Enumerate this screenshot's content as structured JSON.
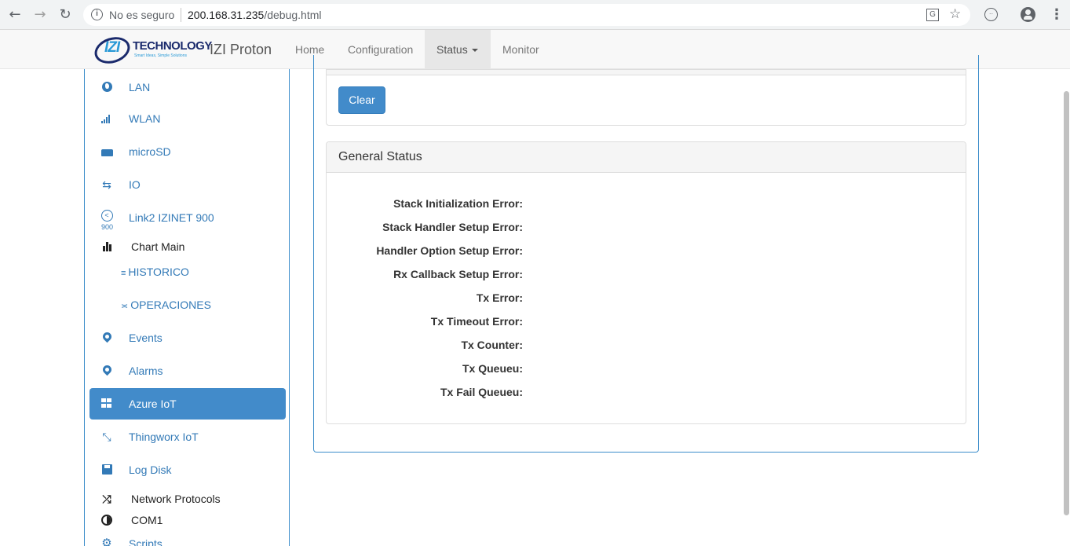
{
  "browser": {
    "security_label": "No es seguro",
    "url_host": "200.168.31.235",
    "url_path": "/debug.html"
  },
  "navbar": {
    "logo_word": "TECHNOLOGY",
    "logo_tagline": "Smart Ideas, Simple Solutions",
    "logo_mark": "IZI",
    "brand": "IZI Proton",
    "items": [
      {
        "label": "Home"
      },
      {
        "label": "Configuration"
      },
      {
        "label": "Status",
        "active": true
      },
      {
        "label": "Monitor"
      }
    ]
  },
  "sidebar": {
    "items": [
      {
        "label": "LAN",
        "icon": "globe-icon"
      },
      {
        "label": "WLAN",
        "icon": "signal-icon"
      },
      {
        "label": "microSD",
        "icon": "drive-icon"
      },
      {
        "label": "IO",
        "icon": "transfer-icon"
      },
      {
        "label": "Link2 IZINET 900",
        "icon": "share-icon",
        "sub_label": "900"
      },
      {
        "label": "Chart Main",
        "icon": "bar-chart-icon"
      },
      {
        "label": "HISTORICO",
        "icon": "list-icon"
      },
      {
        "label": "OPERACIONES",
        "icon": "approx-icon"
      },
      {
        "label": "Events",
        "icon": "map-marker-icon"
      },
      {
        "label": "Alarms",
        "icon": "map-marker-icon"
      },
      {
        "label": "Azure IoT",
        "icon": "windows-icon",
        "active": true
      },
      {
        "label": "Thingworx IoT",
        "icon": "resize-icon"
      },
      {
        "label": "Log Disk",
        "icon": "floppy-icon"
      },
      {
        "label": "Network Protocols",
        "icon": "random-icon"
      },
      {
        "label": "COM1",
        "icon": "contrast-icon"
      },
      {
        "label": "Scripts",
        "icon": "cog-icon"
      }
    ]
  },
  "main": {
    "clear_button": "Clear",
    "general_status": {
      "title": "General Status",
      "rows": [
        {
          "label": "Stack Initialization Error:"
        },
        {
          "label": "Stack Handler Setup Error:"
        },
        {
          "label": "Handler Option Setup Error:"
        },
        {
          "label": "Rx Callback Setup Error:"
        },
        {
          "label": "Tx Error:"
        },
        {
          "label": "Tx Timeout Error:"
        },
        {
          "label": "Tx Counter:"
        },
        {
          "label": "Tx Queueu:"
        },
        {
          "label": "Tx Fail Queueu:"
        }
      ]
    }
  },
  "colors": {
    "link": "#337ab7",
    "active": "#428bca",
    "panel_border": "#3c8dca"
  }
}
